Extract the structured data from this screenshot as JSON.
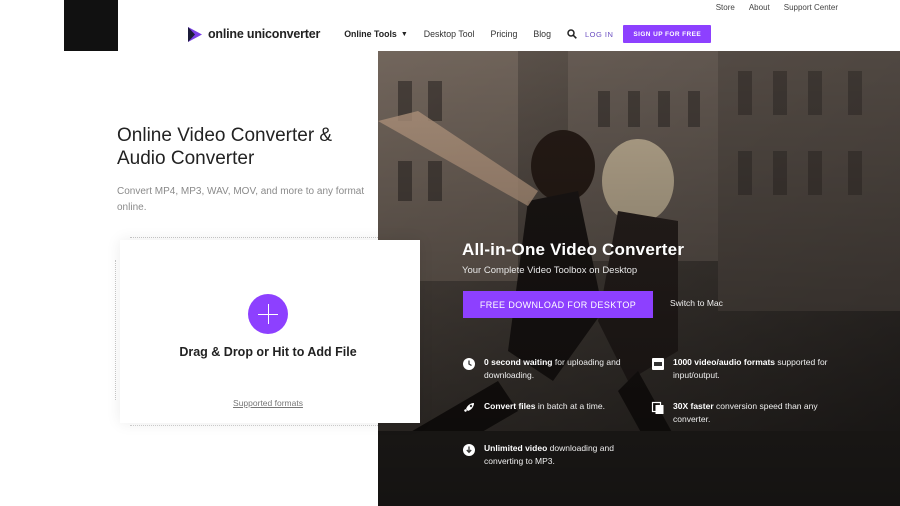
{
  "utility_nav": {
    "store": "Store",
    "about": "About",
    "support": "Support Center"
  },
  "nav": {
    "logo_text": "online uniconverter",
    "online_tools": "Online Tools",
    "desktop_tool": "Desktop Tool",
    "pricing": "Pricing",
    "blog": "Blog",
    "login": "LOG IN",
    "signup": "SIGN UP FOR FREE"
  },
  "hero": {
    "title": "Online Video Converter & Audio Converter",
    "subtitle": "Convert MP4, MP3, WAV, MOV, and more to any format online."
  },
  "upload": {
    "drop_text": "Drag & Drop or Hit to Add File",
    "supported_formats": "Supported formats"
  },
  "promo": {
    "title": "All-in-One Video Converter",
    "subtitle": "Your Complete Video Toolbox on Desktop",
    "download_button": "FREE DOWNLOAD FOR DESKTOP",
    "switch_mac": "Switch to Mac",
    "features": [
      {
        "icon": "clock-icon",
        "bold": "0 second waiting",
        "text": " for uploading and downloading."
      },
      {
        "icon": "film-icon",
        "bold": "1000 video/audio formats",
        "text": " supported for input/output."
      },
      {
        "icon": "rocket-icon",
        "bold": "Convert files",
        "text": " in batch at a time."
      },
      {
        "icon": "copy-icon",
        "bold": "30X faster",
        "text": " conversion speed than any converter."
      },
      {
        "icon": "download-icon",
        "bold": "Unlimited video",
        "text": " downloading and converting to MP3."
      }
    ]
  },
  "colors": {
    "accent": "#8d40ff",
    "dark": "#111111"
  }
}
